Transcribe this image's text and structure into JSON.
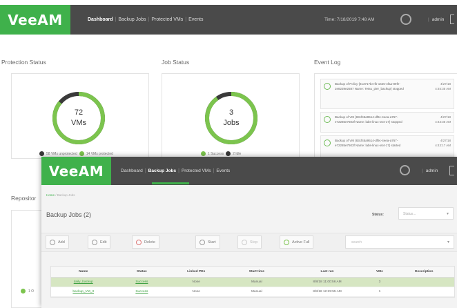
{
  "dashboard": {
    "logo": "VeeAM",
    "nav": [
      "Dashboard",
      "Backup Jobs",
      "Protected VMs",
      "Events"
    ],
    "time": "Time: 7/18/2019 7:48 AM",
    "user": "admin",
    "sections": {
      "protection_status": "Protection Status",
      "job_status": "Job Status",
      "event_log": "Event Log",
      "repository": "Repositor"
    },
    "protection_donut": {
      "value": "72",
      "unit": "VMs",
      "fraction_protected": 0.86
    },
    "job_donut": {
      "value": "3",
      "unit": "Jobs",
      "fraction_success": 0.9
    },
    "protection_legend": [
      "58 VMs unprotected",
      "14 VMs protected"
    ],
    "job_legend": [
      "1 Success",
      "2 Idle"
    ],
    "events": [
      {
        "text": "Backup of Policy {813717b4-fb-1625-4faa-89fe-2e8239e2587 Name: Tetsu_pier_backup} stopped",
        "date": "4/27/18",
        "time": "4:45:35 AM"
      },
      {
        "text": "Backup of VM {83cf45a9514-df9c-4eea-a767-e72285e7503f Name: labs-linux-x64-17} stopped",
        "date": "4/27/18",
        "time": "4:43:35 AM"
      },
      {
        "text": "Backup of VM {83cf45a9514-df9c-4eea-a767-e72285e7503f Name: labs-linux-x64-17} started",
        "date": "4/27/18",
        "time": "4:43:17 AM"
      }
    ],
    "repo_legend": "1 O"
  },
  "backup_jobs": {
    "logo": "VeeAM",
    "nav": [
      "Dashboard",
      "Backup Jobs",
      "Protected VMs",
      "Events"
    ],
    "user": "admin",
    "breadcrumb": [
      "Home",
      "Backup Jobs"
    ],
    "title": "Backup Jobs (2)",
    "status_label": "Status:",
    "status_value": "Status...",
    "toolbar": {
      "add": "Add",
      "edit": "Edit",
      "delete": "Delete",
      "start": "Start",
      "stop": "Stop",
      "active_full": "Active Full",
      "search_placeholder": "search"
    },
    "table": {
      "columns": [
        "Name",
        "Status",
        "Linked PDs",
        "Start time",
        "Last run",
        "VMs",
        "Description"
      ],
      "rows": [
        [
          "daily_backup",
          "Success",
          "None",
          "Manual",
          "8/8/18 11:00:56 AM",
          "3",
          ""
        ],
        [
          "backup_VM_3",
          "Success",
          "None",
          "Manual",
          "8/8/18 12:29:55 AM",
          "1",
          ""
        ]
      ]
    }
  },
  "colors": {
    "brand_green": "#3fb14b",
    "topbar": "#4a4a4a",
    "selected_row": "#d6e6c2",
    "donut_track": "#3a3a3a"
  }
}
